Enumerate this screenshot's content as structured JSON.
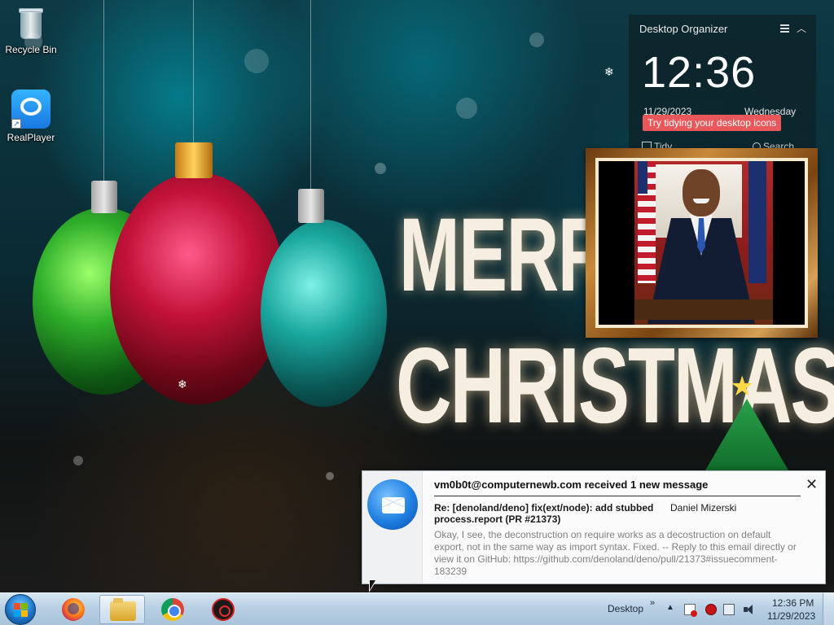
{
  "desktop": {
    "icons": [
      {
        "label": "Recycle Bin",
        "icon": "recycle-bin-icon"
      },
      {
        "label": "RealPlayer",
        "icon": "realplayer-icon"
      }
    ],
    "wallpaper": {
      "line1": "MERRY",
      "line2": "CHRISTMAS"
    }
  },
  "organizer": {
    "title": "Desktop Organizer",
    "time": "12:36",
    "date": "11/29/2023",
    "weekday": "Wednesday",
    "tip": "Try tidying your desktop icons",
    "tidy_label": "Tidy",
    "search_label": "Search"
  },
  "notification": {
    "headline": "vm0b0t@computernewb.com received 1 new message",
    "subject": "Re: [denoland/deno] fix(ext/node): add stubbed process.report (PR #21373)",
    "sender": "Daniel Mizerski",
    "body": "Okay, I see, the deconstruction on require works as a decostruction on default export, not in the same way as import syntax. Fixed. -- Reply to this email directly or view it on GitHub: https://github.com/denoland/deno/pull/21373#issuecomment-183239",
    "close_symbol": "✕"
  },
  "taskbar": {
    "apps": [
      {
        "name": "firefox",
        "icon": "firefox-icon",
        "active": false
      },
      {
        "name": "file-explorer",
        "icon": "folder-icon",
        "active": true
      },
      {
        "name": "chrome",
        "icon": "chrome-icon",
        "active": false
      },
      {
        "name": "app",
        "icon": "red-gear-app-icon",
        "active": false
      }
    ],
    "desktop_toolbar": "Desktop",
    "desktop_toolbar_chevron": "»",
    "tray_expand": "▲",
    "time": "12:36 PM",
    "date": "11/29/2023"
  },
  "colors": {
    "tip_bg": "#e8585a",
    "taskbar_top": "#d7e6f2",
    "taskbar_bottom": "#a9c3da",
    "notif_bg": "#fbfbfb"
  }
}
